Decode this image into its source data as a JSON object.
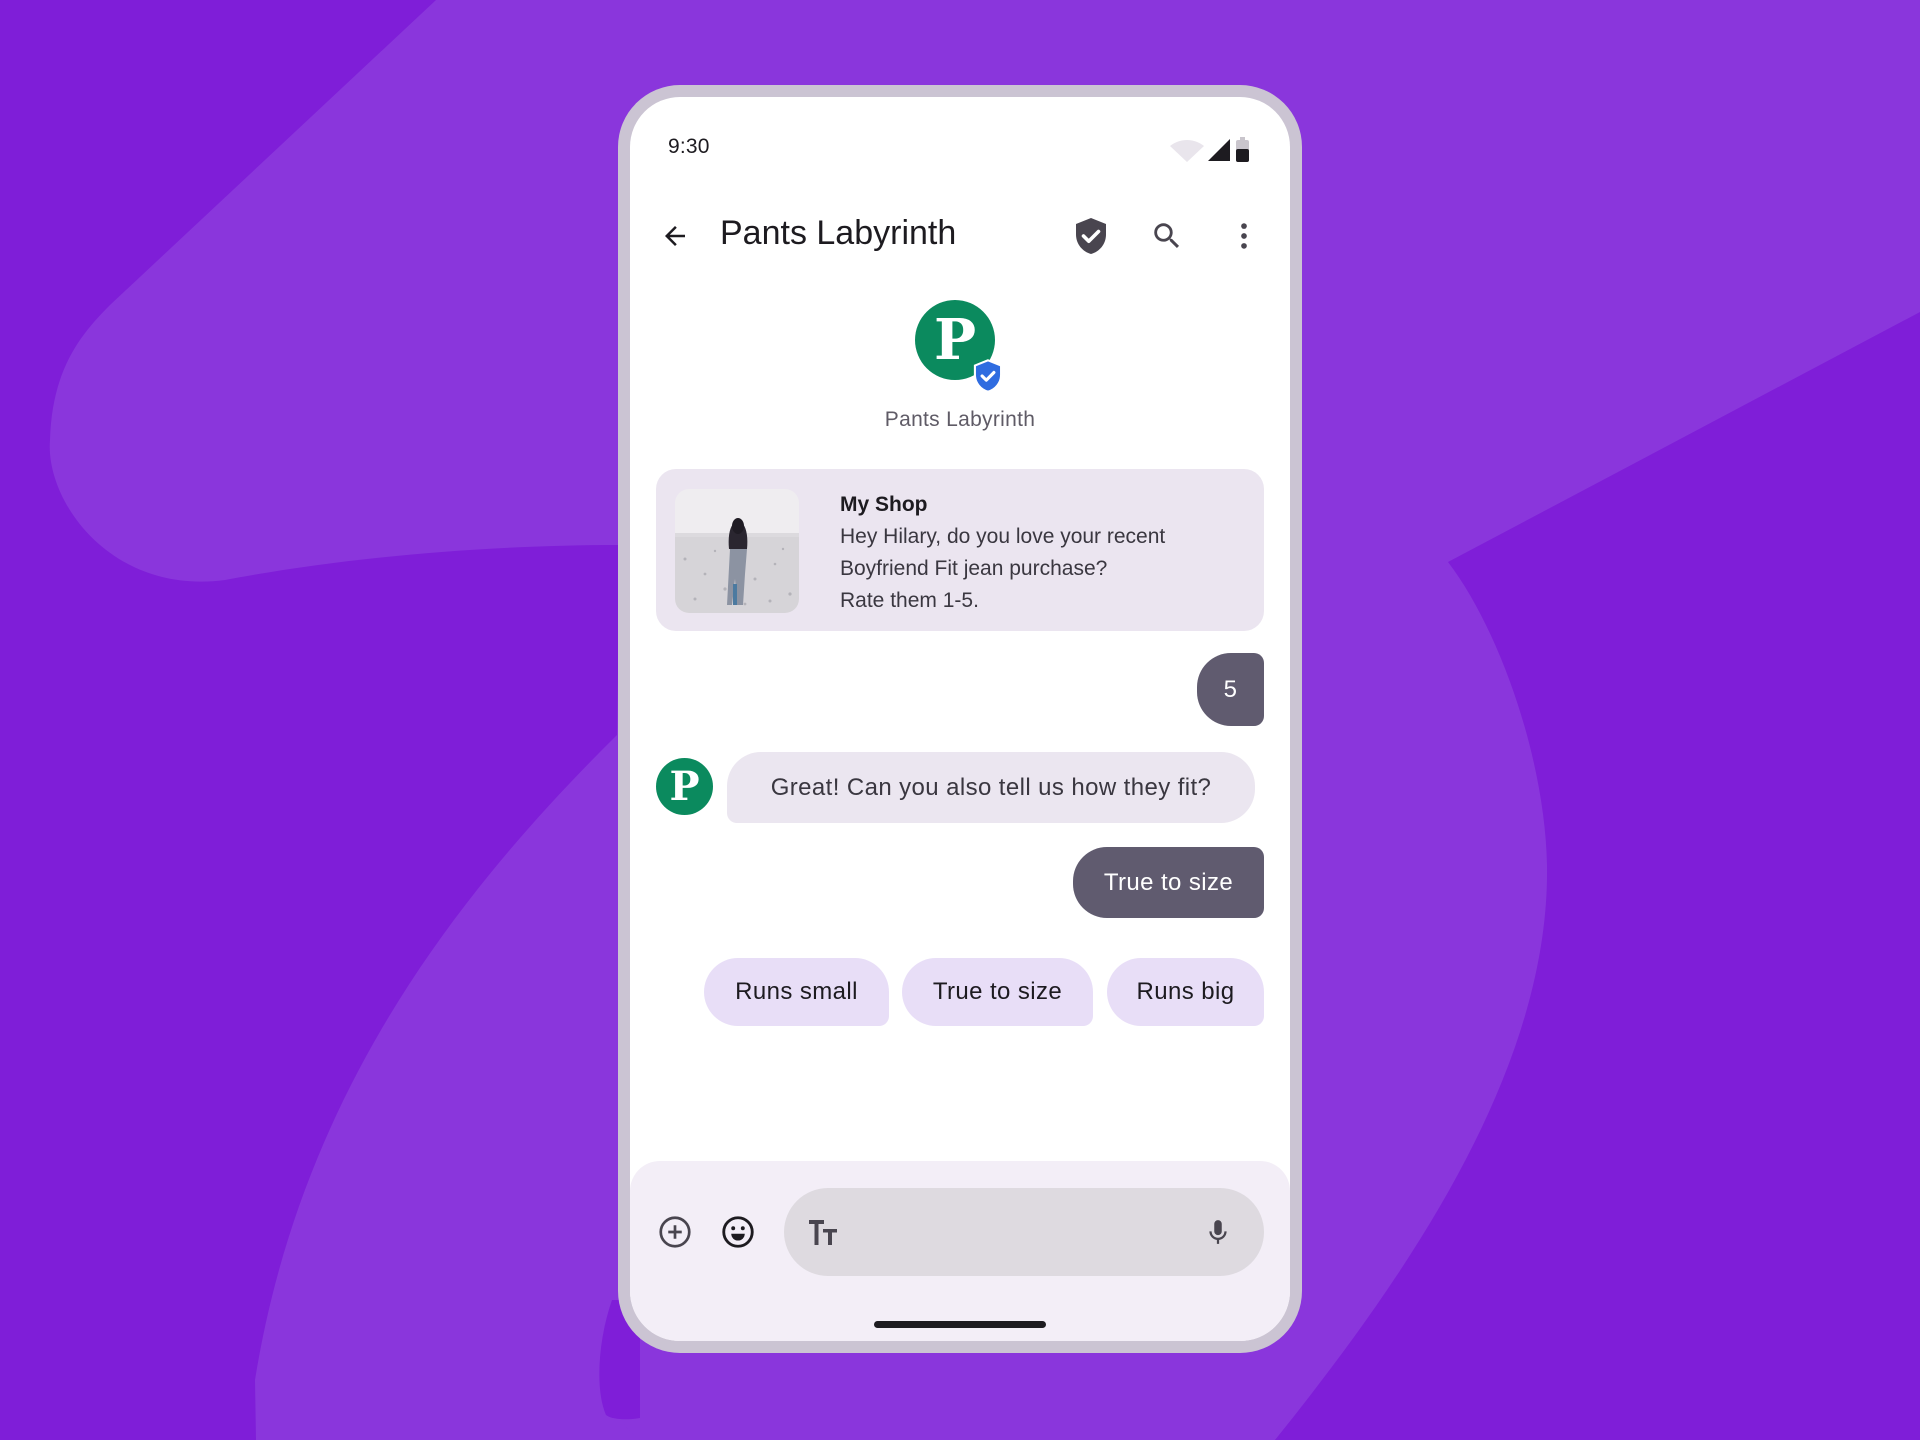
{
  "colors": {
    "background": "#7f1ed8",
    "background_shape": "#8a36dc",
    "phone_frame": "#cbc4d3",
    "brand_green": "#0b8a5e",
    "verified_blue": "#2f6ce0",
    "outgoing_bubble": "#605b6f",
    "incoming_bubble": "#ebe6f0",
    "chip": "#e8def7"
  },
  "status_bar": {
    "time": "9:30",
    "icons": [
      "wifi-icon",
      "cellular-signal-icon",
      "battery-icon"
    ]
  },
  "app_bar": {
    "back_icon": "arrow-back-icon",
    "title": "Pants Labyrinth",
    "actions": [
      "verified-shield-icon",
      "search-icon",
      "more-vert-icon"
    ]
  },
  "business_header": {
    "avatar_letter": "P",
    "name": "Pants Labyrinth",
    "verified": true
  },
  "messages": [
    {
      "type": "rich_card",
      "direction": "incoming",
      "title": "My Shop",
      "lines": [
        "Hey Hilary, do you love your recent",
        "Boyfriend Fit jean purchase?",
        "Rate them 1-5."
      ],
      "image": "person-walking-on-beach-photo"
    },
    {
      "type": "text",
      "direction": "outgoing",
      "text": "5"
    },
    {
      "type": "text",
      "direction": "incoming",
      "avatar_letter": "P",
      "text": "Great! Can you also tell us how they fit?"
    },
    {
      "type": "text",
      "direction": "outgoing",
      "text": "True to size"
    }
  ],
  "suggested_replies": [
    {
      "label": "Runs small"
    },
    {
      "label": "True to size"
    },
    {
      "label": "Runs big"
    }
  ],
  "composer": {
    "add_icon": "add-circle-icon",
    "emoji_icon": "emoji-icon",
    "format_icon": "text-format-icon",
    "format_label": "Tт",
    "placeholder": "",
    "mic_icon": "mic-icon"
  }
}
